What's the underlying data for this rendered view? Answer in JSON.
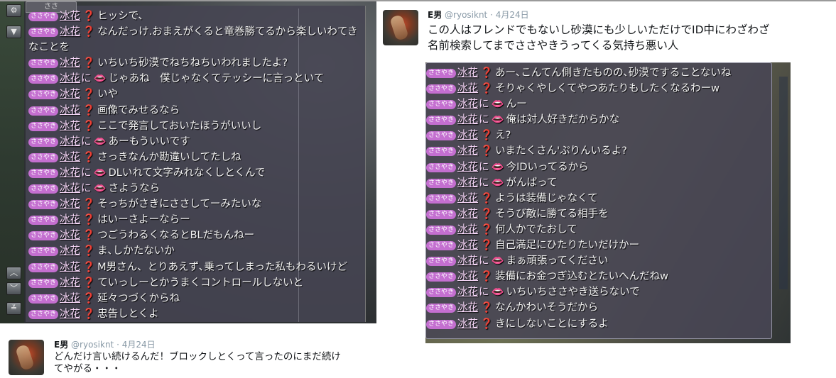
{
  "tweets": {
    "right": {
      "name": "E男",
      "handle": "@ryosiknt",
      "date": "4月24日",
      "text_line1": "この人はフレンドでもないし砂漠にも少しいただけでID中にわざわざ",
      "text_line2": "名前検索してまでささやきうってくる気持ち悪い人"
    },
    "left": {
      "name": "E男",
      "handle": "@ryosiknt",
      "date": "4月24日",
      "text_line1": "どんだけ言い続けるんだ！ブロックしとくって言ったのにまだ続け",
      "text_line2": "てやがる・・・"
    }
  },
  "chat_left": {
    "tab": "ささ",
    "badge": "ささやき",
    "lines": [
      {
        "name": "冰花",
        "to": "",
        "mark": "bubble",
        "text": "ヒッシで、"
      },
      {
        "name": "冰花",
        "to": "",
        "mark": "bubble",
        "text": "なんだっけ.おまえがくると竜巻勝てるから楽しいわてき"
      },
      {
        "name": "",
        "to": "",
        "mark": "",
        "text": "なことを"
      },
      {
        "name": "冰花",
        "to": "",
        "mark": "bubble",
        "text": "いちいち砂漠でねちねちいわれましたよ?"
      },
      {
        "name": "冰花",
        "to": "に",
        "mark": "lips",
        "text": "じゃあね　僕じゃなくてテッシーに言っといて"
      },
      {
        "name": "冰花",
        "to": "",
        "mark": "bubble",
        "text": "いや"
      },
      {
        "name": "冰花",
        "to": "",
        "mark": "bubble",
        "text": "画像でみせるなら"
      },
      {
        "name": "冰花",
        "to": "",
        "mark": "bubble",
        "text": "ここで発言しておいたほうがいいし"
      },
      {
        "name": "冰花",
        "to": "に",
        "mark": "lips",
        "text": "あーもういいです"
      },
      {
        "name": "冰花",
        "to": "",
        "mark": "bubble",
        "text": "さっきなんか勘違いしてたしね"
      },
      {
        "name": "冰花",
        "to": "に",
        "mark": "lips",
        "text": "DLいれて文字みれなくしとくんで"
      },
      {
        "name": "冰花",
        "to": "に",
        "mark": "lips",
        "text": "さようなら"
      },
      {
        "name": "冰花",
        "to": "",
        "mark": "bubble",
        "text": "そっちがさきにささしてーみたいな"
      },
      {
        "name": "冰花",
        "to": "",
        "mark": "bubble",
        "text": "はいーさよーならー"
      },
      {
        "name": "冰花",
        "to": "",
        "mark": "bubble",
        "text": "つごうわるくなるとBLだもんねー"
      },
      {
        "name": "冰花",
        "to": "",
        "mark": "bubble",
        "text": "ま､しかたないか"
      },
      {
        "name": "冰花",
        "to": "",
        "mark": "bubble",
        "text": "M男さん、とりあえず､乗ってしまった私もわるいけど"
      },
      {
        "name": "冰花",
        "to": "",
        "mark": "bubble",
        "text": "ていっしーとかうまくコントロールしないと"
      },
      {
        "name": "冰花",
        "to": "",
        "mark": "bubble",
        "text": "延々つづくからね"
      },
      {
        "name": "冰花",
        "to": "",
        "mark": "bubble",
        "text": "忠告しとくよ"
      }
    ]
  },
  "chat_right": {
    "badge": "ささやき",
    "lines": [
      {
        "name": "冰花",
        "to": "",
        "mark": "bubble",
        "text": "あー､こんてん側きたものの､砂漠ですることないね"
      },
      {
        "name": "冰花",
        "to": "",
        "mark": "bubble",
        "text": "そりゃくやしくてやつあたりもしたくなるわーw"
      },
      {
        "name": "冰花",
        "to": "に",
        "mark": "lips",
        "text": "んー"
      },
      {
        "name": "冰花",
        "to": "に",
        "mark": "lips",
        "text": "俺は対人好きだからかな"
      },
      {
        "name": "冰花",
        "to": "",
        "mark": "bubble",
        "text": "え?"
      },
      {
        "name": "冰花",
        "to": "",
        "mark": "bubble",
        "text": "いまたくさん'ぷりんいるよ?"
      },
      {
        "name": "冰花",
        "to": "に",
        "mark": "lips",
        "text": "今IDいってるから"
      },
      {
        "name": "冰花",
        "to": "に",
        "mark": "lips",
        "text": "がんばって"
      },
      {
        "name": "冰花",
        "to": "",
        "mark": "bubble",
        "text": "ようは装備じゃなくて"
      },
      {
        "name": "冰花",
        "to": "",
        "mark": "bubble",
        "text": "そうび敵に勝てる相手を"
      },
      {
        "name": "冰花",
        "to": "",
        "mark": "bubble",
        "text": "何人かでたおして"
      },
      {
        "name": "冰花",
        "to": "",
        "mark": "bubble",
        "text": "自己満足にひたりたいだけかー"
      },
      {
        "name": "冰花",
        "to": "に",
        "mark": "lips",
        "text": "まぁ頑張ってください"
      },
      {
        "name": "冰花",
        "to": "",
        "mark": "bubble",
        "text": "装備にお金つぎ込むとたいへんだねw"
      },
      {
        "name": "冰花",
        "to": "に",
        "mark": "lips",
        "text": "いちいちささやき送らないで"
      },
      {
        "name": "冰花",
        "to": "",
        "mark": "bubble",
        "text": "なんかわいそうだから"
      },
      {
        "name": "冰花",
        "to": "",
        "mark": "bubble",
        "text": "きにしないことにするよ"
      }
    ]
  },
  "toolbar": {
    "gear_icon": "gear-icon",
    "filter_icon": "filter-icon",
    "scroll_up_icon": "chevron-up-icon",
    "scroll_down_icon": "chevron-down-icon",
    "scroll_bottom_icon": "scroll-bottom-icon"
  },
  "colors": {
    "chat_bg": "#464452",
    "name": "#f5d6f7",
    "badge": "#c46fd0",
    "bubble": "#f5c04a",
    "lips": "#e5434c",
    "tweet_text": "#14171a",
    "tweet_meta": "#8899a6"
  }
}
